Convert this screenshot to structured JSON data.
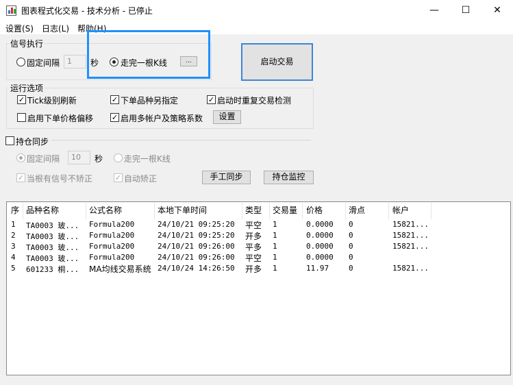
{
  "window": {
    "title": "图表程式化交易 - 技术分析 - 已停止"
  },
  "titlebar_buttons": {
    "minimize": "—",
    "maximize": "☐",
    "close": "✕"
  },
  "menu": [
    "设置(S)",
    "日志(L)",
    "帮助(H)"
  ],
  "signal_exec": {
    "group_label": "信号执行",
    "fixed_interval_label": "固定间隔",
    "interval_value": "1",
    "seconds_label": "秒",
    "kline_label": "走完一根K线",
    "more_button": "...",
    "start_button": "启动交易"
  },
  "run_options": {
    "group_label": "运行选项",
    "tick_refresh": "Tick级别刷新",
    "order_variety": "下单品种另指定",
    "repeat_check": "启动时重复交易检测",
    "price_offset": "启用下单价格偏移",
    "multi_account": "启用多帐户及策略系数",
    "settings_button": "设置"
  },
  "position_sync": {
    "label": "持仓同步",
    "fixed_interval_label": "固定间隔",
    "interval_value": "10",
    "seconds_label": "秒",
    "kline_label": "走完一根K线",
    "no_correct_label": "当根有信号不矫正",
    "auto_correct_label": "自动矫正",
    "manual_sync_button": "手工同步",
    "monitor_button": "持仓监控"
  },
  "table": {
    "columns": [
      "序",
      "品种名称",
      "公式名称",
      "本地下单时间",
      "类型",
      "交易量",
      "价格",
      "滑点",
      "帐户"
    ],
    "rows": [
      [
        "1",
        "TA0003 玻...",
        "Formula200",
        "24/10/21 09:25:20",
        "平空",
        "1",
        "0.0000",
        "0",
        "15821..."
      ],
      [
        "2",
        "TA0003 玻...",
        "Formula200",
        "24/10/21 09:25:20",
        "开多",
        "1",
        "0.0000",
        "0",
        "15821..."
      ],
      [
        "3",
        "TA0003 玻...",
        "Formula200",
        "24/10/21 09:26:00",
        "平多",
        "1",
        "0.0000",
        "0",
        "15821..."
      ],
      [
        "4",
        "TA0003 玻...",
        "Formula200",
        "24/10/21 09:26:00",
        "平空",
        "1",
        "0.0000",
        "0",
        ""
      ],
      [
        "5",
        "601233 桐...",
        "MA均线交易系统",
        "24/10/24 14:26:50",
        "开多",
        "1",
        "11.97",
        "0",
        "15821..."
      ]
    ]
  }
}
